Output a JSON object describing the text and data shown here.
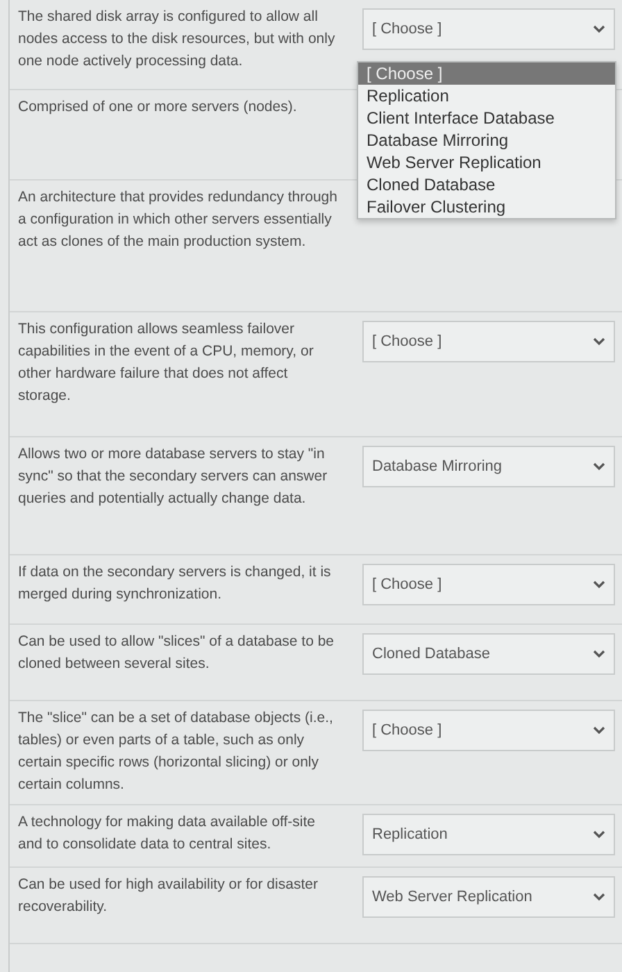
{
  "rows": [
    {
      "prompt": "The shared disk array is configured to allow all nodes access to the disk resources, but with only one node actively processing data.",
      "select": {
        "value": "[ Choose ]"
      }
    },
    {
      "prompt": "Comprised of one or more servers (nodes)."
    },
    {
      "prompt": "An architecture that provides redundancy through a configuration in which other servers essentially act as clones of the main production system."
    },
    {
      "prompt": "This configuration allows seamless failover capabilities in the event of a CPU, memory, or other hardware failure that does not affect storage.",
      "select": {
        "value": "[ Choose ]"
      }
    },
    {
      "prompt": "Allows two or more database servers to stay \"in sync\" so that the secondary servers can answer queries and potentially actually change data.",
      "select": {
        "value": "Database Mirroring"
      }
    },
    {
      "prompt": "If data on the secondary servers is changed, it is merged during synchronization.",
      "select": {
        "value": "[ Choose ]"
      }
    },
    {
      "prompt": "Can be used to allow \"slices\" of a database to be cloned between several sites.",
      "select": {
        "value": "Cloned Database"
      }
    },
    {
      "prompt": "The \"slice\" can be a set of database objects (i.e., tables) or even parts of a table, such as only certain specific rows (horizontal slicing) or only certain columns.",
      "select": {
        "value": "[ Choose ]"
      }
    },
    {
      "prompt": "A technology for making data available off-site and to consolidate data to central sites.",
      "select": {
        "value": "Replication"
      }
    },
    {
      "prompt": "Can be used for high availability or for disaster recoverability.",
      "select": {
        "value": "Web Server Replication"
      }
    }
  ],
  "open_dropdown": {
    "options": [
      {
        "label": "[ Choose ]",
        "selected": true
      },
      {
        "label": "Replication",
        "selected": false
      },
      {
        "label": "Client Interface Database",
        "selected": false
      },
      {
        "label": "Database Mirroring",
        "selected": false
      },
      {
        "label": "Web Server Replication",
        "selected": false
      },
      {
        "label": "Cloned Database",
        "selected": false
      },
      {
        "label": "Failover Clustering",
        "selected": false
      }
    ]
  }
}
